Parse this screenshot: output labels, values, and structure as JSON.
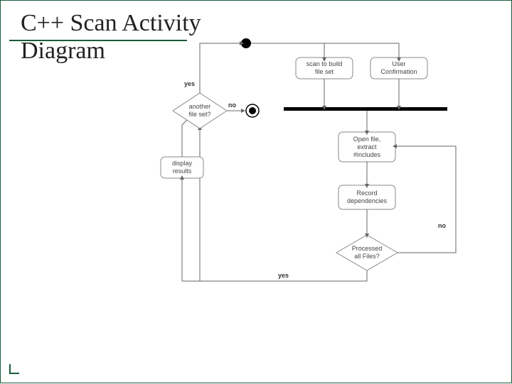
{
  "title_line1": "C++ Scan Activity",
  "title_line2": "Diagram",
  "nodes": {
    "scan_build": {
      "l1": "scan to build",
      "l2": "file set"
    },
    "user_conf": {
      "l1": "User",
      "l2": "Confirmation"
    },
    "open_file": {
      "l1": "Open file,",
      "l2": "extract",
      "l3": "#includes"
    },
    "record": {
      "l1": "Record",
      "l2": "dependencies"
    },
    "processed": {
      "l1": "Processed",
      "l2": "all Files?"
    },
    "another": {
      "l1": "another",
      "l2": "file set?"
    },
    "display": {
      "l1": "display",
      "l2": "results"
    }
  },
  "edges": {
    "yes_top": "yes",
    "no_mid": "no",
    "yes_bottom": "yes",
    "no_right": "no"
  }
}
